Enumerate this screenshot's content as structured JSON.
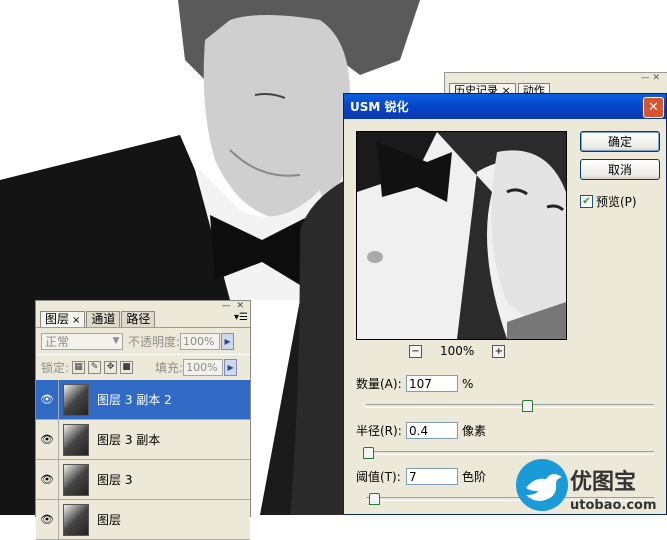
{
  "history_panel": {
    "tab_history": "历史记录",
    "tab_actions": "动作"
  },
  "layers_panel": {
    "tabs": [
      {
        "label": "图层",
        "close": "×"
      },
      {
        "label": "通道"
      },
      {
        "label": "路径"
      }
    ],
    "blend_mode": "正常",
    "opacity_label": "不透明度:",
    "opacity_value": "100%",
    "lock_label": "锁定:",
    "fill_label": "填充:",
    "fill_value": "100%",
    "layers": [
      {
        "name": "图层 3 副本 2",
        "selected": true
      },
      {
        "name": "图层 3 副本",
        "selected": false
      },
      {
        "name": "图层 3",
        "selected": false
      },
      {
        "name": "图层",
        "selected": false
      }
    ]
  },
  "dialog": {
    "title": "USM 锐化",
    "ok_label": "确定",
    "cancel_label": "取消",
    "preview_label": "预览(P)",
    "preview_checked": true,
    "zoom_minus": "−",
    "zoom_value": "100%",
    "zoom_plus": "+",
    "amount_label": "数量(A):",
    "amount_value": "107",
    "amount_unit": "%",
    "radius_label": "半径(R):",
    "radius_value": "0.4",
    "radius_unit": "像素",
    "threshold_label": "阈值(T):",
    "threshold_value": "7",
    "threshold_unit": "色阶"
  },
  "watermark": {
    "text": "优图宝",
    "url": "utobao.com"
  },
  "colors": {
    "selected_row": "#316ac5",
    "title_bar": "#0640c6",
    "panel_bg": "#ece9d8",
    "watermark_blue": "#1a9ad6"
  }
}
